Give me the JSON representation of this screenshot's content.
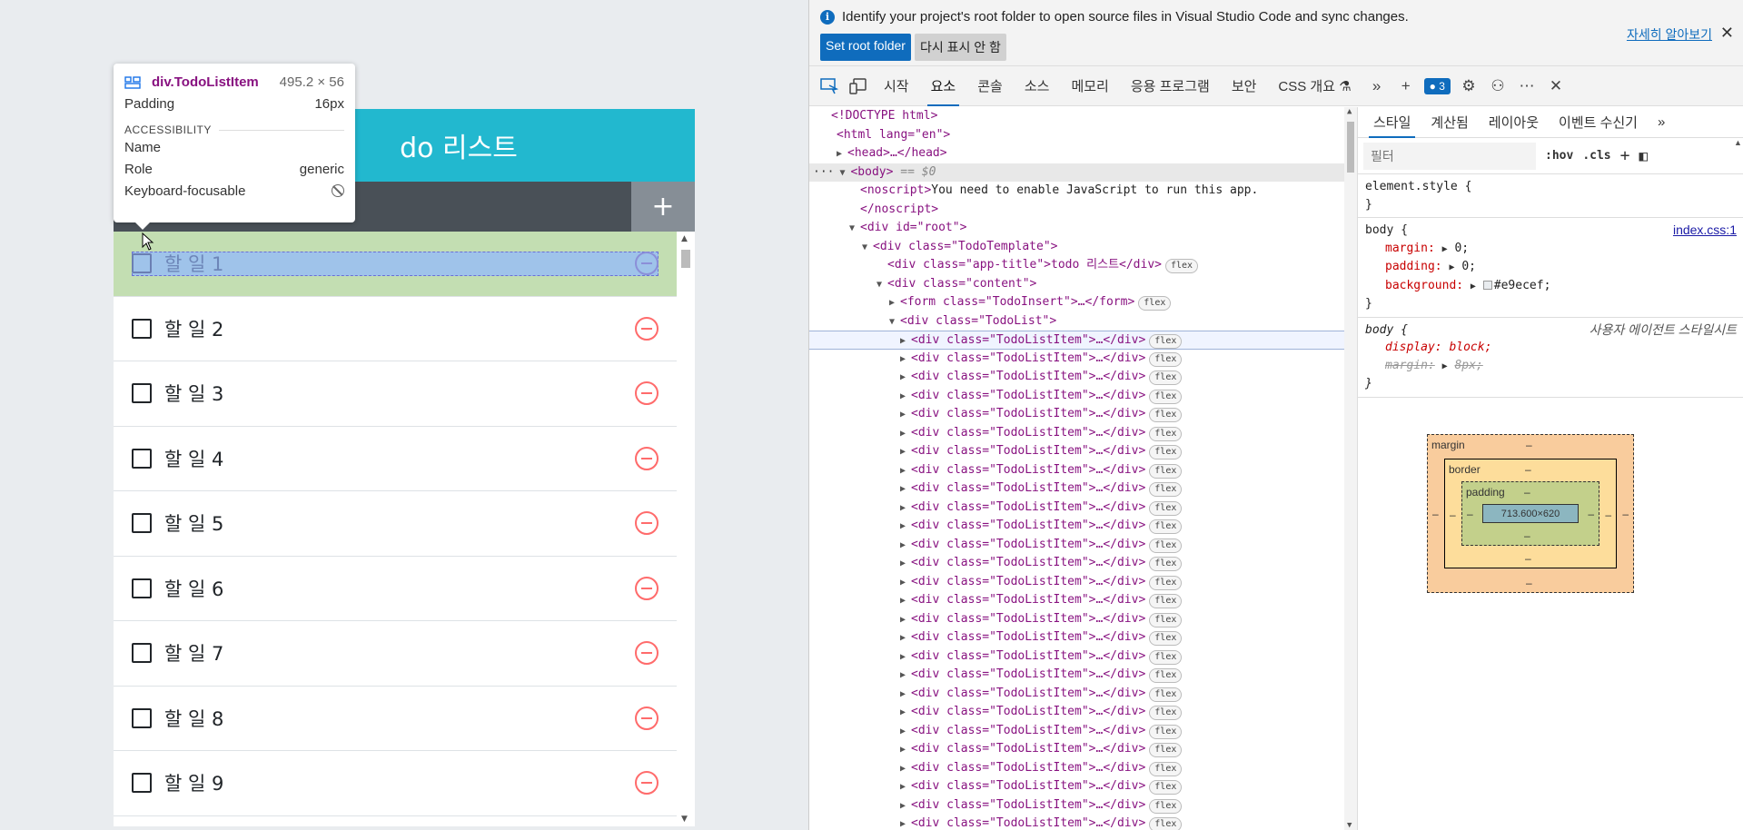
{
  "app": {
    "title": "todo 리스트",
    "title_visible": "do 리스트",
    "add_button": "+",
    "todos": [
      "할 일 1",
      "할 일 2",
      "할 일 3",
      "할 일 4",
      "할 일 5",
      "할 일 6",
      "할 일 7",
      "할 일 8",
      "할 일 9"
    ],
    "colors": {
      "title_bg": "#22b8cf",
      "insert_bg": "#495057",
      "remove": "#ff6b6b",
      "page_bg": "#e9ecef"
    }
  },
  "tooltip": {
    "element": "div.TodoListItem",
    "dimensions": "495.2 × 56",
    "padding_label": "Padding",
    "padding_value": "16px",
    "section": "ACCESSIBILITY",
    "name_label": "Name",
    "role_label": "Role",
    "role_value": "generic",
    "keyboard_label": "Keyboard-focusable"
  },
  "devtools": {
    "infobar": {
      "message": "Identify your project's root folder to open source files in Visual Studio Code and sync changes.",
      "set_root": "Set root folder",
      "dont_show": "다시 표시 안 함",
      "learn_more": "자세히 알아보기"
    },
    "tabs": [
      "시작",
      "요소",
      "콘솔",
      "소스",
      "메모리",
      "응용 프로그램",
      "보안",
      "CSS 개요 ⚗"
    ],
    "active_tab": "요소",
    "issues_count": "3",
    "dom": {
      "doctype": "<!DOCTYPE html>",
      "html_open": "<html lang=\"en\">",
      "head": "<head>…</head>",
      "body": "<body>",
      "body_eq": "== $0",
      "noscript_open": "<noscript>",
      "noscript_text": "You need to enable JavaScript to run this app.",
      "noscript_close": "</noscript>",
      "root": "<div id=\"root\">",
      "template": "<div class=\"TodoTemplate\">",
      "app_title_line": "<div class=\"app-title\">todo 리스트</div>",
      "content": "<div class=\"content\">",
      "form": "<form class=\"TodoInsert\">…</form>",
      "list": "<div class=\"TodoList\">",
      "item": "<div class=\"TodoListItem\">…</div>",
      "flex_badge": "flex",
      "item_count": 27
    },
    "styles": {
      "tabs": [
        "스타일",
        "계산됨",
        "레이아웃",
        "이벤트 수신기"
      ],
      "active_tab": "스타일",
      "filter_placeholder": "필터",
      "hov": ":hov",
      "cls": ".cls",
      "element_style": "element.style {",
      "close_brace": "}",
      "body_rule": {
        "selector": "body {",
        "source": "index.css:1",
        "margin": "margin:",
        "margin_val": "0;",
        "padding": "padding:",
        "padding_val": "0;",
        "background": "background:",
        "background_val": "#e9ecef;"
      },
      "ua_rule": {
        "selector": "body {",
        "source": "사용자 에이전트 스타일시트",
        "display": "display: block;",
        "margin": "margin:",
        "margin_val": "8px;"
      },
      "box_model": {
        "margin": "margin",
        "border": "border",
        "padding": "padding",
        "content": "713.600×620",
        "dash": "–"
      }
    }
  }
}
